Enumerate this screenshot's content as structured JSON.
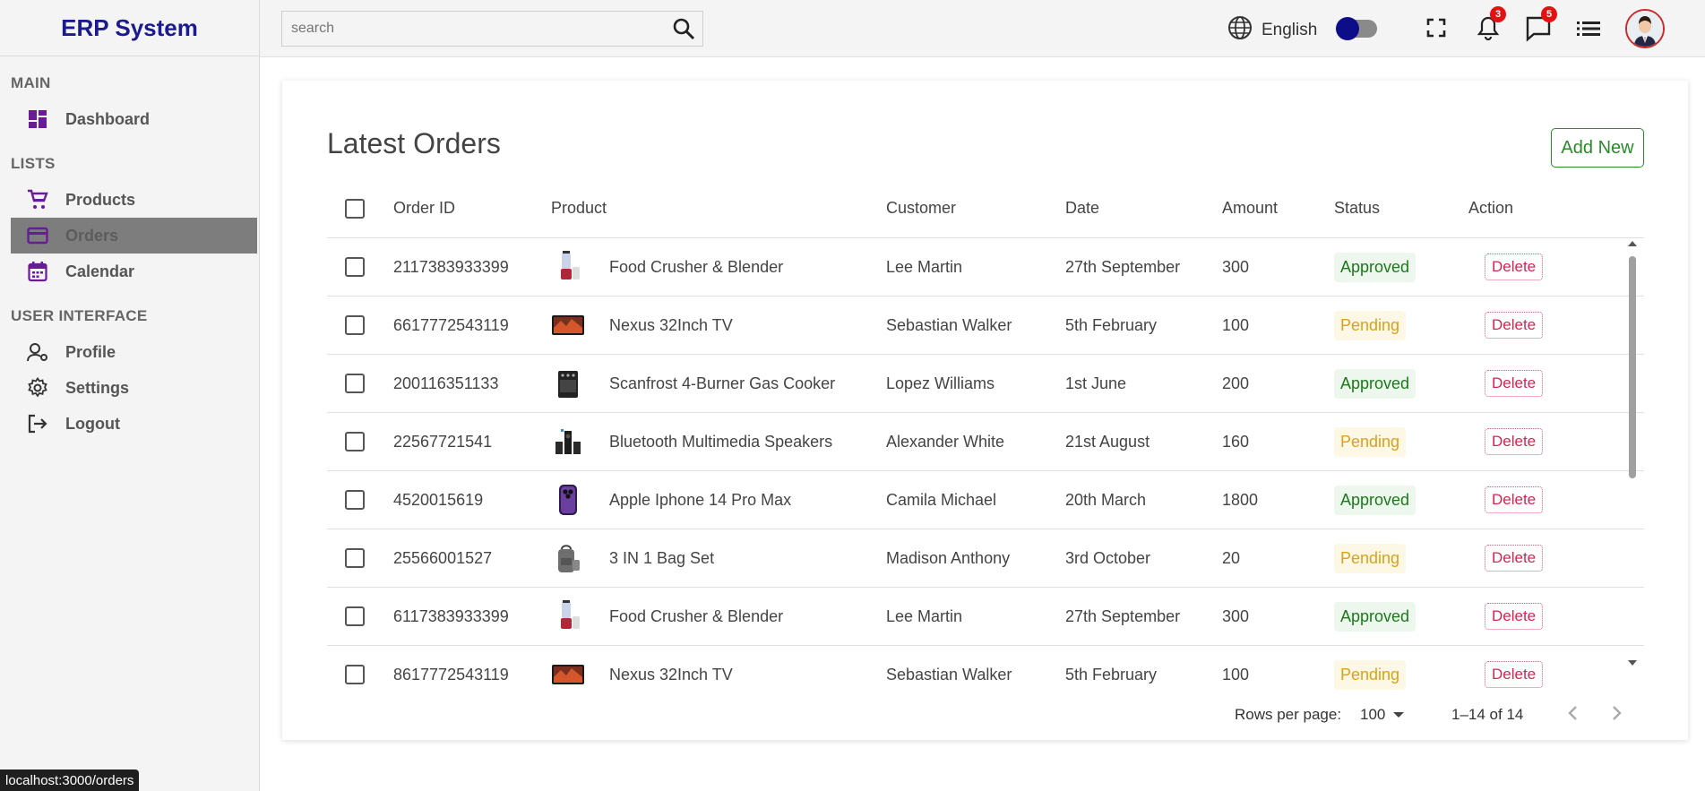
{
  "app": {
    "title": "ERP System"
  },
  "sidebar": {
    "sections": [
      {
        "title": "MAIN",
        "items": [
          {
            "label": "Dashboard",
            "icon": "dashboard-icon"
          }
        ]
      },
      {
        "title": "LISTS",
        "items": [
          {
            "label": "Products",
            "icon": "cart-icon"
          },
          {
            "label": "Orders",
            "icon": "credit-card-icon",
            "active": true
          },
          {
            "label": "Calendar",
            "icon": "calendar-icon"
          }
        ]
      },
      {
        "title": "USER INTERFACE",
        "items": [
          {
            "label": "Profile",
            "icon": "profile-icon"
          },
          {
            "label": "Settings",
            "icon": "gear-icon"
          },
          {
            "label": "Logout",
            "icon": "logout-icon"
          }
        ]
      }
    ]
  },
  "topbar": {
    "search_placeholder": "search",
    "language": "English",
    "notifications_count": "3",
    "messages_count": "5"
  },
  "orders": {
    "title": "Latest Orders",
    "add_label": "Add New",
    "columns": [
      "Order ID",
      "Product",
      "Customer",
      "Date",
      "Amount",
      "Status",
      "Action"
    ],
    "rows": [
      {
        "id": "2117383933399",
        "product": "Food Crusher & Blender",
        "img": "blender",
        "customer": "Lee Martin",
        "date": "27th September",
        "amount": "300",
        "status": "Approved",
        "action": "Delete"
      },
      {
        "id": "6617772543119",
        "product": "Nexus 32Inch TV",
        "img": "tv",
        "customer": "Sebastian Walker",
        "date": "5th February",
        "amount": "100",
        "status": "Pending",
        "action": "Delete"
      },
      {
        "id": "200116351133",
        "product": "Scanfrost 4-Burner Gas Cooker",
        "img": "cooker",
        "customer": "Lopez Williams",
        "date": "1st June",
        "amount": "200",
        "status": "Approved",
        "action": "Delete"
      },
      {
        "id": "22567721541",
        "product": "Bluetooth Multimedia Speakers",
        "img": "speakers",
        "customer": "Alexander White",
        "date": "21st August",
        "amount": "160",
        "status": "Pending",
        "action": "Delete"
      },
      {
        "id": "4520015619",
        "product": "Apple Iphone 14 Pro Max",
        "img": "phone",
        "customer": "Camila Michael",
        "date": "20th March",
        "amount": "1800",
        "status": "Approved",
        "action": "Delete"
      },
      {
        "id": "25566001527",
        "product": "3 IN 1 Bag Set",
        "img": "bag",
        "customer": "Madison Anthony",
        "date": "3rd October",
        "amount": "20",
        "status": "Pending",
        "action": "Delete"
      },
      {
        "id": "6117383933399",
        "product": "Food Crusher & Blender",
        "img": "blender",
        "customer": "Lee Martin",
        "date": "27th September",
        "amount": "300",
        "status": "Approved",
        "action": "Delete"
      },
      {
        "id": "8617772543119",
        "product": "Nexus 32Inch TV",
        "img": "tv",
        "customer": "Sebastian Walker",
        "date": "5th February",
        "amount": "100",
        "status": "Pending",
        "action": "Delete"
      }
    ],
    "footer": {
      "rows_per_page_label": "Rows per page:",
      "rows_per_page": "100",
      "range": "1–14 of 14"
    }
  },
  "browser_status": "localhost:3000/orders",
  "colors": {
    "accent": "#1b1b8f",
    "icon": "#6a1b9a",
    "approved": "#1a7a1a",
    "pending": "#d9a21a",
    "delete": "#d62452"
  }
}
